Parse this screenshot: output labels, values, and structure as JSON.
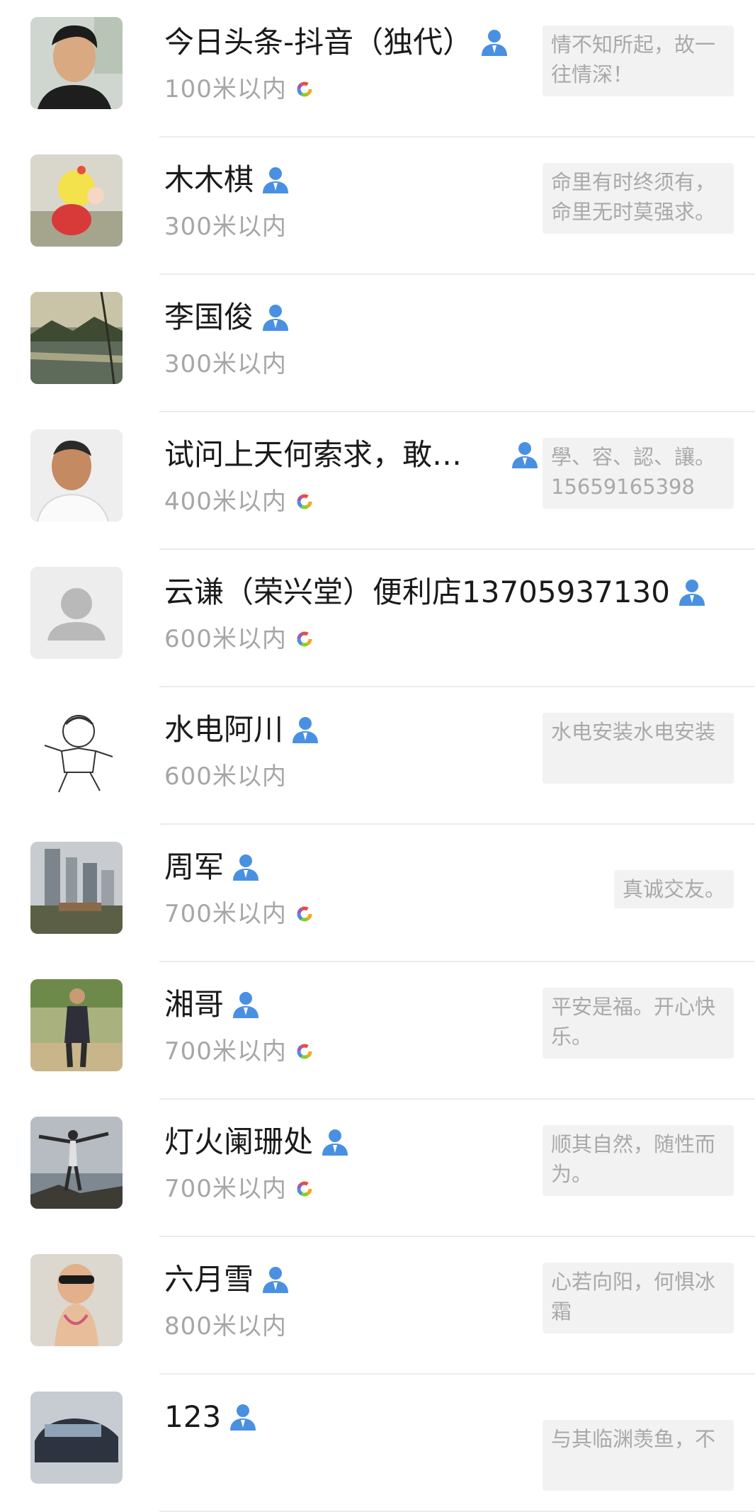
{
  "contacts": [
    {
      "name": "今日头条-抖音（独代）",
      "distance": "100米以内",
      "moments": true,
      "signature": "情不知所起，故一往情深！"
    },
    {
      "name": "木木棋",
      "distance": "300米以内",
      "moments": false,
      "signature": "命里有时终须有，命里无时莫强求。"
    },
    {
      "name": "李国俊",
      "distance": "300米以内",
      "moments": false,
      "signature": ""
    },
    {
      "name": "试问上天何索求，敢…",
      "distance": "400米以内",
      "moments": true,
      "signature": "學、容、認、讓。15659165398"
    },
    {
      "name": "云谦（荣兴堂）便利店13705937130",
      "distance": "600米以内",
      "moments": true,
      "signature": ""
    },
    {
      "name": "水电阿川",
      "distance": "600米以内",
      "moments": false,
      "signature": "水电安装水电安装"
    },
    {
      "name": "周军",
      "distance": "700米以内",
      "moments": true,
      "signature": "真诚交友。"
    },
    {
      "name": "湘哥",
      "distance": "700米以内",
      "moments": true,
      "signature": "平安是福。开心快乐。"
    },
    {
      "name": "灯火阑珊处",
      "distance": "700米以内",
      "moments": true,
      "signature": "顺其自然，随性而为。"
    },
    {
      "name": "六月雪",
      "distance": "800米以内",
      "moments": false,
      "signature": "心若向阳，何惧冰霜"
    },
    {
      "name": "123",
      "distance": "",
      "moments": false,
      "signature": "与其临渊羡鱼，不"
    }
  ],
  "colors": {
    "verify_blue": "#4a90e2",
    "distance_gray": "#a6a6a6",
    "signature_bg": "#f2f2f2"
  },
  "icons": {
    "verify": "person-verified-icon",
    "moments": "color-ring-icon"
  }
}
